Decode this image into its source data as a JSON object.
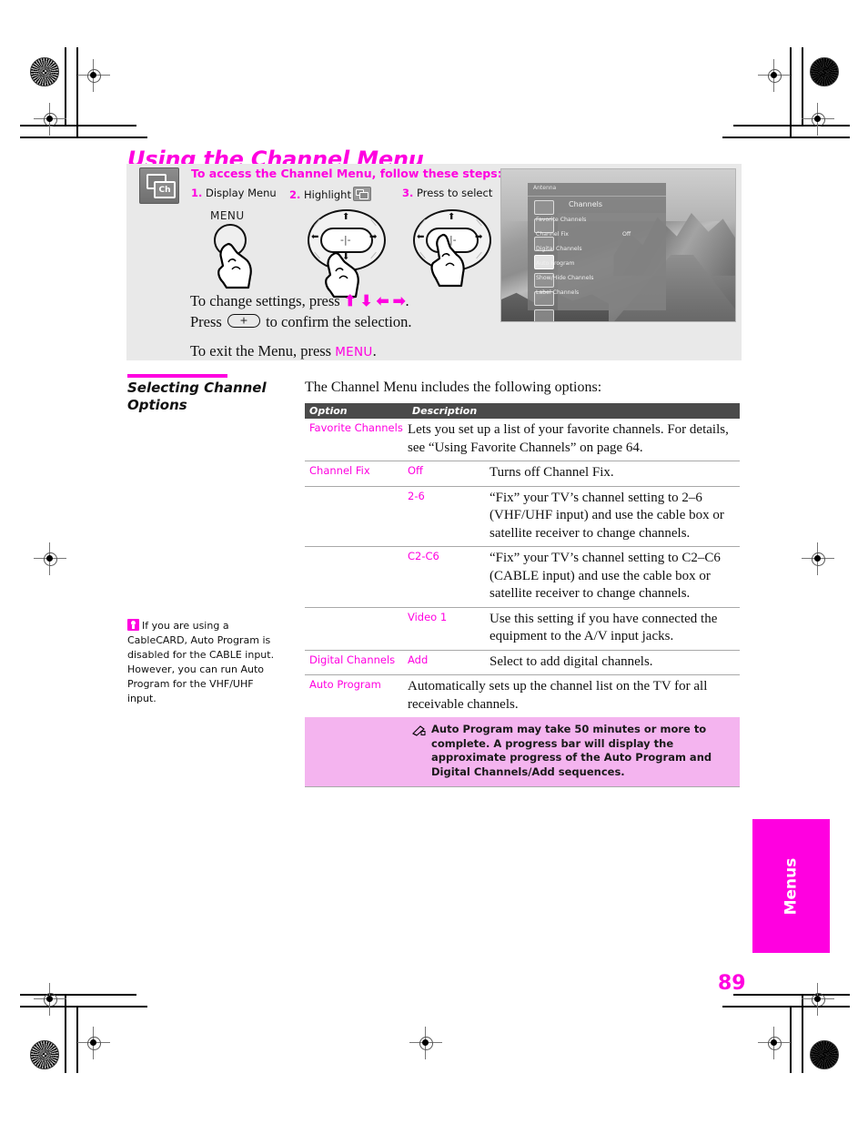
{
  "page": {
    "title": "Using the Channel Menu",
    "number": "89",
    "side_tab": "Menus"
  },
  "steps_panel": {
    "icon_label": "Ch",
    "heading": "To access the Channel Menu, follow these steps:",
    "step1_num": "1.",
    "step1_label": "Display Menu",
    "step2_num": "2.",
    "step2_label": "Highlight",
    "step3_num": "3.",
    "step3_label": "Press to select",
    "menu_button_word": "MENU",
    "line1_a": "To change settings, press",
    "line1_arrows": "⬆ ⬇ ⬅ ➡",
    "line1_b": ".",
    "line2_a": "Press",
    "line2_b": "to confirm the selection.",
    "line3_a": "To exit the Menu, press",
    "line3_kw": "MENU",
    "line3_b": "."
  },
  "tv_screen": {
    "antenna_label": "Antenna",
    "menu_title": "Channels",
    "items": [
      {
        "label": "Favorite Channels",
        "value": ""
      },
      {
        "label": "Channel Fix",
        "value": "Off"
      },
      {
        "label": "Digital Channels",
        "value": ""
      },
      {
        "label": "Auto Program",
        "value": ""
      },
      {
        "label": "Show/Hide Channels",
        "value": ""
      },
      {
        "label": "Label Channels",
        "value": ""
      }
    ]
  },
  "section": {
    "heading_line1": "Selecting Channel",
    "heading_line2": "Options",
    "intro": "The Channel Menu includes the following options:"
  },
  "table": {
    "header": {
      "option": "Option",
      "description": "Description"
    },
    "rows": [
      {
        "option": "Favorite Channels",
        "sub": "",
        "desc": "Lets you set up a list of your favorite channels. For details, see “Using Favorite Channels” on page 64."
      },
      {
        "option": "Channel Fix",
        "sub": "Off",
        "desc": "Turns off Channel Fix."
      },
      {
        "option": "",
        "sub": "2-6",
        "desc": "“Fix” your TV’s channel setting to 2–6 (VHF/UHF input) and use the cable box or satellite receiver to change channels."
      },
      {
        "option": "",
        "sub": "C2-C6",
        "desc": "“Fix” your TV’s channel setting to C2–C6 (CABLE input) and use the cable box or satellite receiver to change channels."
      },
      {
        "option": "",
        "sub": "Video 1",
        "desc": "Use this setting if you have connected the equipment to the A/V input jacks."
      },
      {
        "option": "Digital Channels",
        "sub": "Add",
        "desc": "Select to add digital channels."
      },
      {
        "option": "Auto Program",
        "sub": "",
        "desc": "Automatically sets up the channel list on the TV for all receivable channels."
      }
    ],
    "note": "Auto Program may take 50 minutes or more to complete. A progress bar will display the approximate progress of the Auto Program and Digital Channels/Add sequences."
  },
  "margin_note": {
    "text": "If you are using a CableCARD, Auto Program is disabled for the CABLE input. However, you can run Auto Program for the VHF/UHF input."
  },
  "colors": {
    "magenta": "#ff00e0",
    "note_pink": "#f4b4ef",
    "panel_gray": "#e9e9e9",
    "table_header": "#4a4a4a"
  }
}
